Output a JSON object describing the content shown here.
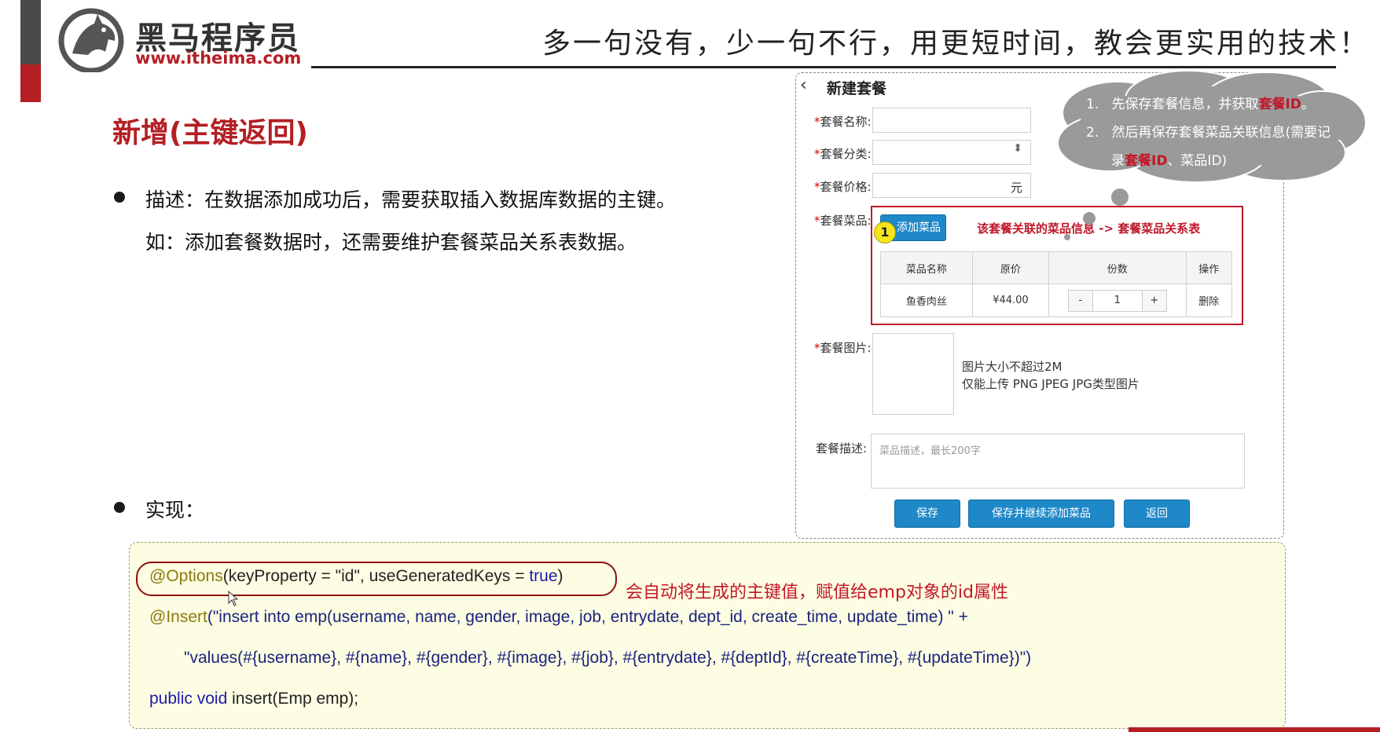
{
  "header": {
    "logo_name": "黑马程序员",
    "logo_url": "www.itheima.com",
    "slogan": "多一句没有，少一句不行，用更短时间，教会更实用的技术！"
  },
  "section": {
    "title": "新增(主键返回)",
    "desc_line1": "描述：在数据添加成功后，需要获取插入数据库数据的主键。",
    "desc_line2": "如：添加套餐数据时，还需要维护套餐菜品关系表数据。",
    "impl_label": "实现："
  },
  "form": {
    "back_icon": "chevron-left-icon",
    "title": "新建套餐",
    "name_label": "套餐名称:",
    "category_label": "套餐分类:",
    "price_label": "套餐价格:",
    "price_unit": "元",
    "dishes_label": "套餐菜品:",
    "add_dish_button": "添加菜品",
    "step_number": "1",
    "dish_note": "该套餐关联的菜品信息  ->  套餐菜品关系表",
    "table": {
      "headers": [
        "菜品名称",
        "原价",
        "份数",
        "操作"
      ],
      "rows": [
        {
          "name": "鱼香肉丝",
          "price": "¥44.00",
          "minus": "-",
          "qty": "1",
          "plus": "+",
          "action": "删除"
        }
      ]
    },
    "image_label": "套餐图片:",
    "image_tip1": "图片大小不超过2M",
    "image_tip2": "仅能上传 PNG JPEG JPG类型图片",
    "desc_label": "套餐描述:",
    "desc_placeholder": "菜品描述，最长200字",
    "save_button": "保存",
    "save_continue_button": "保存并继续添加菜品",
    "return_button": "返回"
  },
  "callout": {
    "item1_num": "1.",
    "item1_text": "先保存套餐信息，并获取",
    "item1_red": "套餐ID",
    "item1_end": "。",
    "item2_num": "2.",
    "item2_text": "然后再保存套餐菜品关联信息(需要记",
    "item2_cont_pre": "录",
    "item2_red": "套餐ID",
    "item2_cont_post": "、菜品ID)"
  },
  "code": {
    "options_anno": "@Options",
    "options_args": "(keyProperty = \"id\", useGeneratedKeys = ",
    "options_true": "true",
    "options_close": ")",
    "note": "会自动将生成的主键值，赋值给emp对象的id属性",
    "insert_anno": "@Insert",
    "insert_sql": "(\"insert into emp(username, name, gender, image, job, entrydate, dept_id, create_time, update_time) \" +",
    "values_sql": "\"values(#{username}, #{name}, #{gender}, #{image}, #{job}, #{entrydate}, #{deptId}, #{createTime}, #{updateTime})\")",
    "method_public": "public",
    "method_void": "void",
    "method_rest": "insert(Emp emp);"
  },
  "colors": {
    "brand_red": "#b41f24",
    "primary_blue": "#1e88c8",
    "code_bg": "#fdfde3"
  }
}
